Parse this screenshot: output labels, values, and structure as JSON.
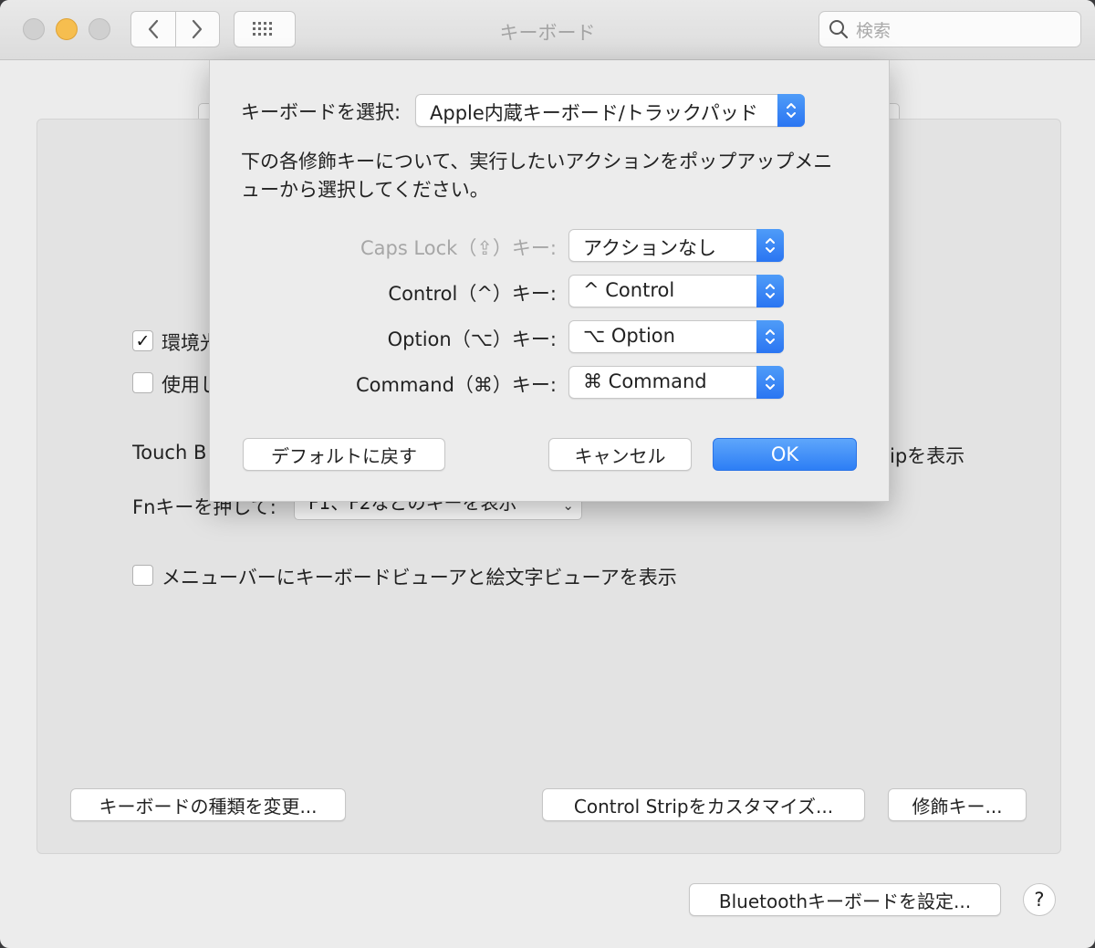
{
  "window": {
    "title": "キーボード"
  },
  "search": {
    "placeholder": "検索"
  },
  "background": {
    "checkbox_1_label": "環境光",
    "checkbox_2_label": "使用し",
    "touchbar_label": "Touch B",
    "strip_suffix": "ipを表示",
    "fn_label": "Fnキーを押して:",
    "fn_select_value": "F1、F2などのキーを表示",
    "menubar_checkbox_label": "メニューバーにキーボードビューアと絵文字ビューアを表示",
    "change_type_button": "キーボードの種類を変更...",
    "customize_strip_button": "Control Stripをカスタマイズ...",
    "modifier_button": "修飾キー...",
    "bluetooth_button": "Bluetoothキーボードを設定...",
    "help_button": "?"
  },
  "sheet": {
    "keyboard_label": "キーボードを選択:",
    "keyboard_value": "Apple内蔵キーボード/トラックパッド",
    "description": "下の各修飾キーについて、実行したいアクションをポップアップメニューから選択してください。",
    "description_line1": "下の各修飾キーについて、実行したいアクションをポップアップメニ",
    "description_line2": "ューから選択してください。",
    "rows": [
      {
        "label": "Caps Lock（⇪）キー:",
        "value": "アクションなし",
        "disabled": true
      },
      {
        "label": "Control（^）キー:",
        "value": "^ Control",
        "disabled": false
      },
      {
        "label": "Option（⌥）キー:",
        "value": "⌥ Option",
        "disabled": false
      },
      {
        "label": "Command（⌘）キー:",
        "value": "⌘ Command",
        "disabled": false
      }
    ],
    "default_button": "デフォルトに戻す",
    "cancel_button": "キャンセル",
    "ok_button": "OK"
  },
  "colors": {
    "accent": "#2d7ef5",
    "minimize": "#f6be4f"
  },
  "icons": [
    "back-icon",
    "forward-icon",
    "grid-icon",
    "search-icon",
    "checkmark-icon",
    "chevron-down-icon",
    "updown-stepper-icon"
  ]
}
